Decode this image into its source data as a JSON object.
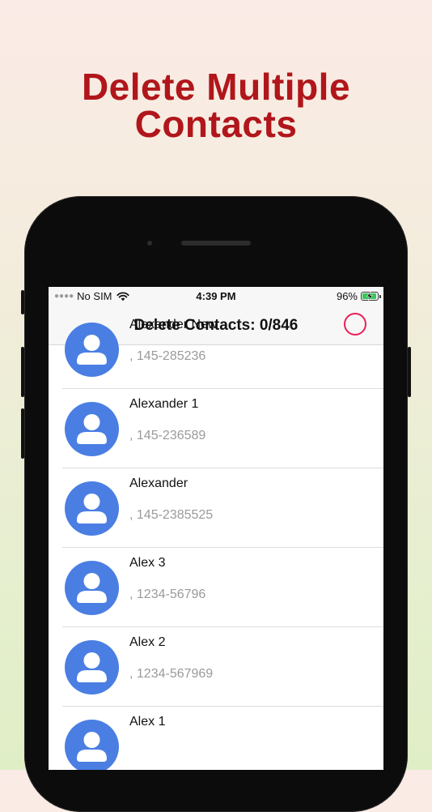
{
  "headline": {
    "line1": "Delete Multiple",
    "line2": "Contacts"
  },
  "status_bar": {
    "carrier": "No SIM",
    "time": "4:39 PM",
    "battery": "96%",
    "battery_level": 0.96
  },
  "nav": {
    "title": "Delete Contacts: 0/846"
  },
  "colors": {
    "headline": "#b0161b",
    "avatar": "#4a7ee3",
    "select_ring": "#e9205a",
    "battery_fill": "#36c75a"
  },
  "contacts": [
    {
      "name": "Alexander New",
      "phone": ", 145-285236"
    },
    {
      "name": "Alexander 1",
      "phone": ", 145-236589"
    },
    {
      "name": "Alexander",
      "phone": ", 145-2385525"
    },
    {
      "name": "Alex 3",
      "phone": ", 1234-56796"
    },
    {
      "name": "Alex 2",
      "phone": ", 1234-567969"
    },
    {
      "name": "Alex 1",
      "phone": ""
    }
  ]
}
